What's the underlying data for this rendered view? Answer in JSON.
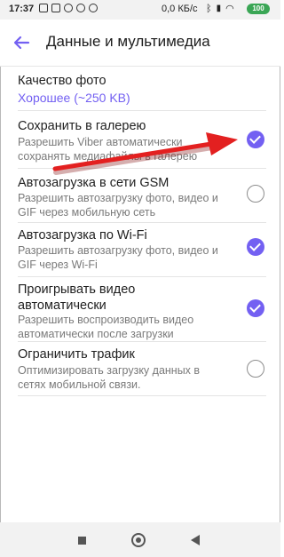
{
  "status_bar": {
    "time": "17:37",
    "network_speed": "0,0 КБ/с",
    "battery": "100"
  },
  "app_bar": {
    "title": "Данные и мультимедиа",
    "back_icon": "arrow-left-icon"
  },
  "settings": {
    "photo_quality": {
      "title": "Качество фото",
      "value": "Хорошее (~250 KB)"
    },
    "save_to_gallery": {
      "title": "Сохранить в галерею",
      "line1": "Разрешить Viber автоматически",
      "line2": "сохранять медиафайлы в галерею",
      "checked": true
    },
    "autoload_gsm": {
      "title": "Автозагрузка в сети GSM",
      "line1": "Разрешить автозагрузку фото, видео и",
      "line2": "GIF через мобильную сеть",
      "checked": false
    },
    "autoload_wifi": {
      "title": "Автозагрузка по Wi-Fi",
      "line1": "Разрешить автозагрузку фото, видео и",
      "line2": "GIF через Wi-Fi",
      "checked": true
    },
    "autoplay_video": {
      "title1": "Проигрывать видео",
      "title2": "автоматически",
      "line1": "Разрешить воспроизводить видео",
      "line2": "автоматически после загрузки",
      "checked": true
    },
    "limit_traffic": {
      "title": "Ограничить трафик",
      "line1": "Оптимизировать загрузку данных в",
      "line2": "сетях мобильной связи.",
      "checked": false
    }
  },
  "colors": {
    "accent": "#7360f2",
    "arrow": "#e32020"
  }
}
